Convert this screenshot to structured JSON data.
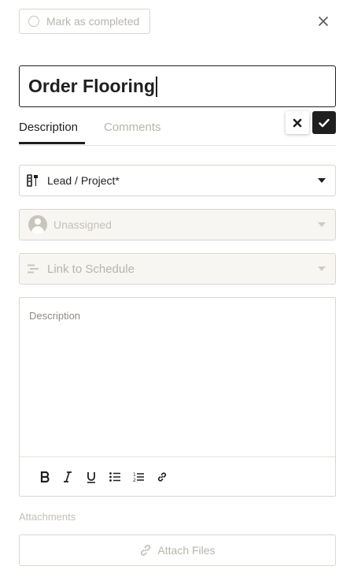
{
  "header": {
    "mark_completed_label": "Mark as completed",
    "close_icon": "close-icon"
  },
  "task": {
    "title": "Order Flooring"
  },
  "edit_actions": {
    "cancel_icon": "x-icon",
    "confirm_icon": "check-icon"
  },
  "tabs": [
    {
      "label": "Description",
      "active": true
    },
    {
      "label": "Comments",
      "active": false
    }
  ],
  "fields": {
    "lead_project": {
      "label": "Lead / Project*",
      "icon": "tools-icon"
    },
    "assignee": {
      "label": "Unassigned",
      "icon": "avatar-icon"
    },
    "schedule": {
      "label": "Link to Schedule",
      "icon": "schedule-bars-icon"
    }
  },
  "description": {
    "placeholder": "Description",
    "toolbar": [
      "bold",
      "italic",
      "underline",
      "bulleted-list",
      "numbered-list",
      "link"
    ]
  },
  "attachments": {
    "label": "Attachments",
    "button_label": "Attach Files"
  },
  "colors": {
    "text_primary": "#1f1f1f",
    "text_muted": "#b8b4ac",
    "border": "#d9d6cf",
    "disabled_bg": "#f7f6f3"
  }
}
